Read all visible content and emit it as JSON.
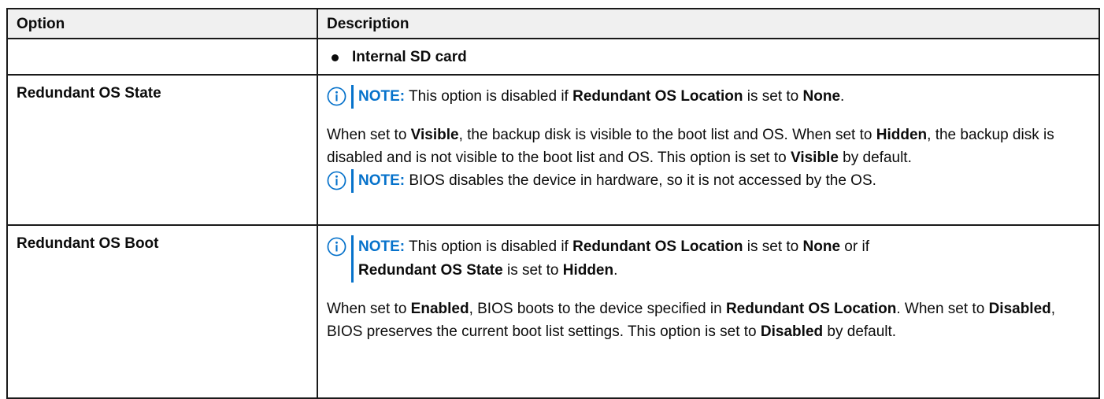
{
  "table": {
    "headers": {
      "option": "Option",
      "description": "Description"
    },
    "rows": [
      {
        "option": "",
        "bullet": "Internal SD card"
      },
      {
        "option": "Redundant OS State",
        "note1": {
          "label": "NOTE:",
          "t1": " This option is disabled if ",
          "b1": "Redundant OS Location",
          "t2": " is set to ",
          "b2": "None",
          "t3": "."
        },
        "para": {
          "t1": "When set to ",
          "b1": "Visible",
          "t2": ", the backup disk is visible to the boot list and OS. When set to ",
          "b2": "Hidden",
          "t3": ", the backup disk is disabled and is not visible to the boot list and OS. This option is set to ",
          "b3": "Visible",
          "t4": " by default."
        },
        "note2": {
          "label": "NOTE:",
          "t1": " BIOS disables the device in hardware, so it is not accessed by the OS."
        }
      },
      {
        "option": "Redundant OS Boot",
        "note1": {
          "label": "NOTE:",
          "t1": " This option is disabled if ",
          "b1": "Redundant OS Location",
          "t2": " is set to ",
          "b2": "None",
          "t3": " or if ",
          "b3": "Redundant OS State",
          "t4": " is set to ",
          "b4": "Hidden",
          "t5": "."
        },
        "para": {
          "t1": "When set to ",
          "b1": "Enabled",
          "t2": ", BIOS boots to the device specified in ",
          "b2": "Redundant OS Location",
          "t3": ". When set to ",
          "b3": "Disabled",
          "t4": ", BIOS preserves the current boot list settings. This option is set to ",
          "b4": "Disabled",
          "t5": " by default."
        }
      }
    ]
  },
  "colors": {
    "note_accent": "#0672cb",
    "header_bg": "#f0f0f0",
    "border": "#1a1a1a",
    "text": "#0c0c0c"
  },
  "icons": {
    "note": "info-circle-icon",
    "bullet": "bullet-dot"
  }
}
